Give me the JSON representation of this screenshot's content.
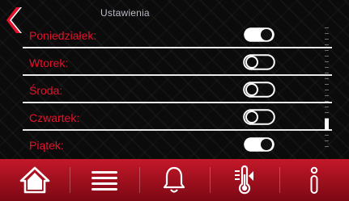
{
  "header": {
    "title": "Ustawienia",
    "back_icon": "chevron-left-icon",
    "accent_color": "#e8102a"
  },
  "days": [
    {
      "label": "Poniedziałek:",
      "enabled": true
    },
    {
      "label": "Wtorek:",
      "enabled": false
    },
    {
      "label": "Środa:",
      "enabled": false
    },
    {
      "label": "Czwartek:",
      "enabled": false
    },
    {
      "label": "Piątek:",
      "enabled": true
    }
  ],
  "scrollbar": {
    "position": 0.8
  },
  "nav": {
    "items": [
      {
        "icon": "home-icon"
      },
      {
        "icon": "menu-icon"
      },
      {
        "icon": "bell-icon"
      },
      {
        "icon": "thermometer-icon"
      },
      {
        "icon": "info-icon"
      }
    ],
    "bar_color": "#b3121f"
  }
}
